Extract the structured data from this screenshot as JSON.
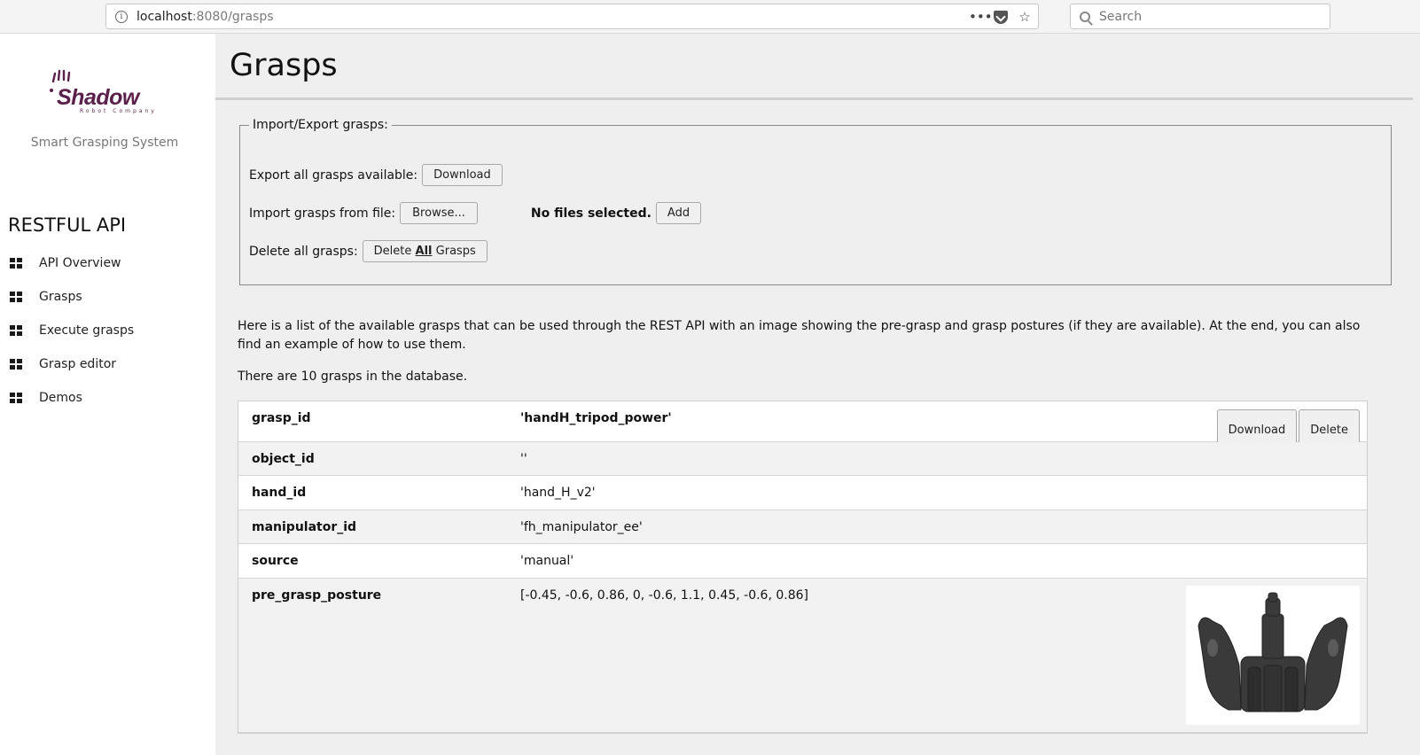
{
  "browser": {
    "url_host": "localhost",
    "url_path": ":8080/grasps",
    "search_placeholder": "Search",
    "info_glyph": "i",
    "more_glyph": "•••",
    "star_glyph": "☆"
  },
  "sidebar": {
    "logo_text": "Shadow",
    "logo_sub": "Robot Company",
    "tagline": "Smart Grasping System",
    "section_title": "RESTFUL API",
    "items": [
      {
        "label": "API Overview",
        "icon": "grid-icon"
      },
      {
        "label": "Grasps",
        "icon": "grid-icon"
      },
      {
        "label": "Execute grasps",
        "icon": "grid-icon"
      },
      {
        "label": "Grasp editor",
        "icon": "grid-icon"
      },
      {
        "label": "Demos",
        "icon": "grid-icon"
      }
    ]
  },
  "main": {
    "title": "Grasps",
    "import_export": {
      "legend": "Import/Export grasps:",
      "export_label": "Export all grasps available:",
      "export_button": "Download",
      "import_label": "Import grasps from file:",
      "browse_button": "Browse...",
      "no_files": "No files selected.",
      "add_button": "Add",
      "delete_label": "Delete all grasps:",
      "delete_button_pre": "Delete ",
      "delete_button_bold": "All",
      "delete_button_post": " Grasps"
    },
    "intro": "Here is a list of the available grasps that can be used through the REST API with an image showing the pre-grasp and grasp postures (if they are available). At the end, you can also find an example of how to use them.",
    "count_text": "There are 10 grasps in the database.",
    "grasp": {
      "download_button": "Download",
      "delete_button": "Delete",
      "rows": [
        {
          "key": "grasp_id",
          "value": "'handH_tripod_power'"
        },
        {
          "key": "object_id",
          "value": "''"
        },
        {
          "key": "hand_id",
          "value": "'hand_H_v2'"
        },
        {
          "key": "manipulator_id",
          "value": "'fh_manipulator_ee'"
        },
        {
          "key": "source",
          "value": "'manual'"
        },
        {
          "key": "pre_grasp_posture",
          "value": "[-0.45, -0.6, 0.86, 0, -0.6, 1.1, 0.45, -0.6, 0.86]"
        }
      ]
    }
  },
  "colors": {
    "brand": "#5a1f4a",
    "page_bg": "#efefef"
  }
}
